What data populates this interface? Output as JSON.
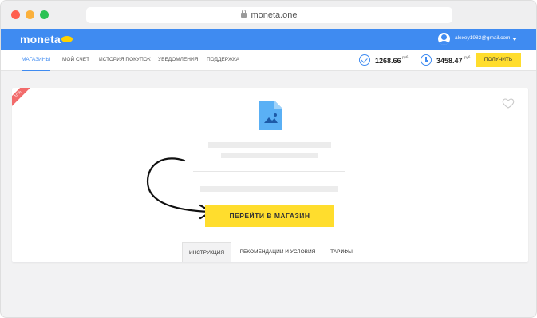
{
  "browser": {
    "url": "moneta.one"
  },
  "header": {
    "logo": "moneta",
    "user_email": "alexey1982@gmail.com"
  },
  "nav": {
    "items": [
      {
        "label": "МАГАЗИНЫ",
        "active": true
      },
      {
        "label": "МОЙ СЧЕТ",
        "active": false
      },
      {
        "label": "ИСТОРИЯ ПОКУПОК",
        "active": false
      },
      {
        "label": "УВЕДОМЛЕНИЯ",
        "active": false
      },
      {
        "label": "ПОДДЕРЖКА",
        "active": false
      }
    ],
    "balance_confirmed": "1268.66",
    "balance_confirmed_currency": "руб",
    "balance_pending": "3458.47",
    "balance_pending_currency": "руб",
    "withdraw_label": "ПОЛУЧИТЬ"
  },
  "card": {
    "ribbon": "10%",
    "go_button": "ПЕРЕЙТИ В МАГАЗИН",
    "tabs": [
      {
        "label": "ИНСТРУКЦИЯ",
        "active": true
      },
      {
        "label": "РЕКОМЕНДАЦИИ И УСЛОВИЯ",
        "active": false
      },
      {
        "label": "ТАРИФЫ",
        "active": false
      }
    ]
  },
  "colors": {
    "brand_blue": "#3f8bf1",
    "accent_yellow": "#ffdd2d",
    "ribbon_red": "#f26b6b"
  }
}
